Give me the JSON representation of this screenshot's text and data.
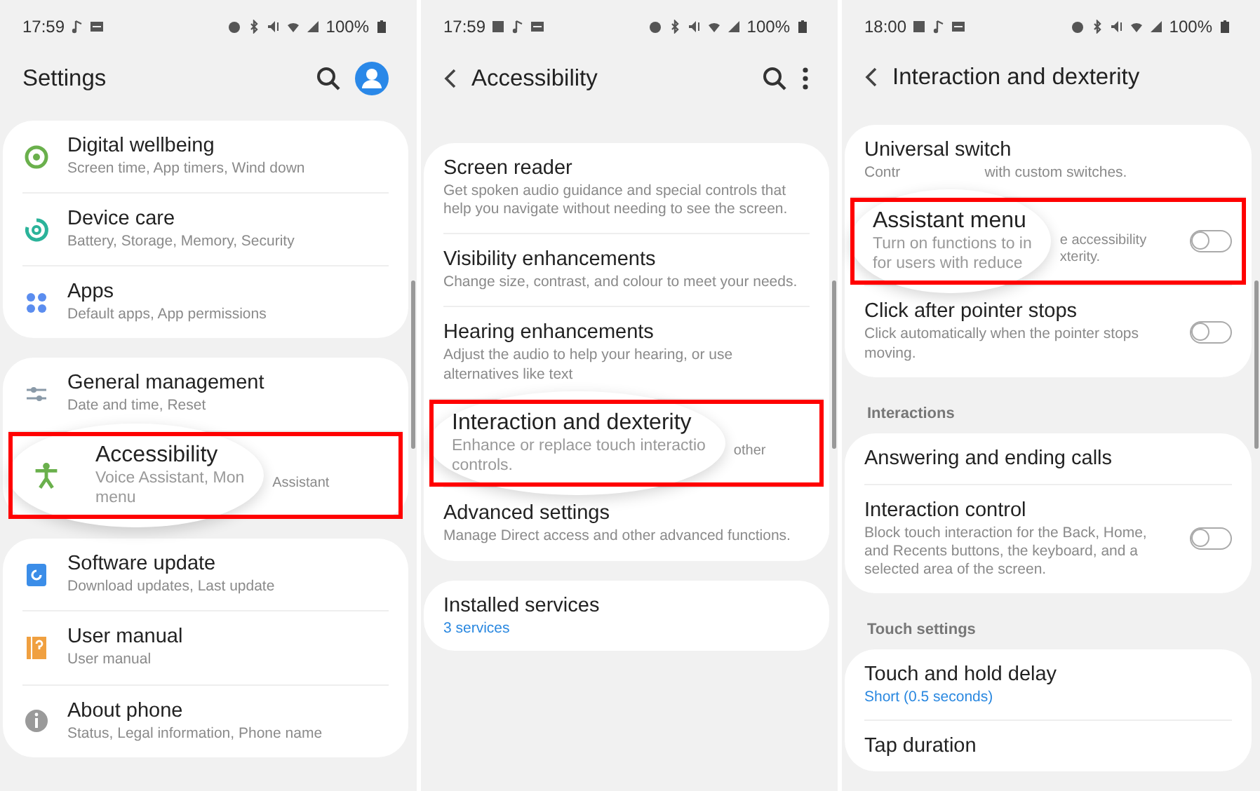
{
  "panels": [
    {
      "kind": "icons",
      "status": {
        "time": "17:59",
        "battery": "100%"
      },
      "header": {
        "title": "Settings",
        "search": true,
        "profile": true
      },
      "sections": [
        {
          "items": [
            {
              "title": "Digital wellbeing",
              "subtitle": "Screen time, App timers, Wind down"
            },
            {
              "title": "Device care",
              "subtitle": "Battery, Storage, Memory, Security"
            },
            {
              "title": "Apps",
              "subtitle": "Default apps, App permissions"
            }
          ]
        },
        {
          "items": [
            {
              "title": "General management",
              "subtitle": "Date and time, Reset"
            },
            {
              "title": "Accessibility",
              "highlighted": true,
              "magnified_subtitle": [
                "Voice Assistant, Mon",
                "menu"
              ],
              "subtitle_behind": [
                "Assistant"
              ]
            }
          ]
        },
        {
          "items": [
            {
              "title": "Software update",
              "subtitle": "Download updates, Last update"
            },
            {
              "title": "User manual",
              "subtitle": "User manual"
            },
            {
              "title": "About phone",
              "subtitle": "Status, Legal information, Phone name"
            }
          ]
        }
      ]
    },
    {
      "kind": "plain",
      "status": {
        "time": "17:59",
        "battery": "100%"
      },
      "header": {
        "title": "Accessibility",
        "back": true,
        "search": true,
        "more": true
      },
      "sections": [
        {
          "items": [
            {
              "title": "Screen reader",
              "subtitle": "Get spoken audio guidance and special controls that help you navigate without needing to see the screen."
            },
            {
              "title": "Visibility enhancements",
              "subtitle": "Change size, contrast, and colour to meet your needs."
            },
            {
              "title": "Hearing enhancements",
              "subtitle": "Adjust the audio to help your hearing, or use alternatives like text"
            },
            {
              "title": "Interaction and dexterity",
              "highlighted": true,
              "magnified_subtitle": [
                "Enhance or replace touch interactio",
                "controls."
              ],
              "subtitle_behind": [
                "other"
              ]
            },
            {
              "title": "Advanced settings",
              "subtitle": "Manage Direct access and other advanced functions."
            }
          ]
        },
        {
          "items": [
            {
              "title": "Installed services",
              "value": "3 services"
            }
          ]
        }
      ]
    },
    {
      "kind": "plain",
      "status": {
        "time": "18:00",
        "battery": "100%"
      },
      "header": {
        "title": "Interaction and dexterity",
        "back": true
      },
      "sections": [
        {
          "items": [
            {
              "title": "Universal switch",
              "subtitle_parts": [
                "Contr",
                "with custom switches."
              ]
            },
            {
              "title": "Assistant menu",
              "highlighted": true,
              "magnified_subtitle": [
                "Turn on functions to in",
                "for users with reduce"
              ],
              "subtitle_behind": [
                "e accessibility",
                "xterity."
              ],
              "toggle": {
                "on": false
              }
            },
            {
              "title": "Click after pointer stops",
              "subtitle": "Click automatically when the pointer stops moving.",
              "toggle": {
                "on": false
              }
            }
          ]
        },
        {
          "label": "Interactions",
          "items": [
            {
              "title": "Answering and ending calls"
            },
            {
              "title": "Interaction control",
              "subtitle": "Block touch interaction for the Back, Home, and Recents buttons, the keyboard, and a selected area of the screen.",
              "toggle": {
                "on": false
              }
            }
          ]
        },
        {
          "label": "Touch settings",
          "items": [
            {
              "title": "Touch and hold delay",
              "value": "Short (0.5 seconds)"
            },
            {
              "title": "Tap duration"
            }
          ]
        }
      ]
    }
  ]
}
